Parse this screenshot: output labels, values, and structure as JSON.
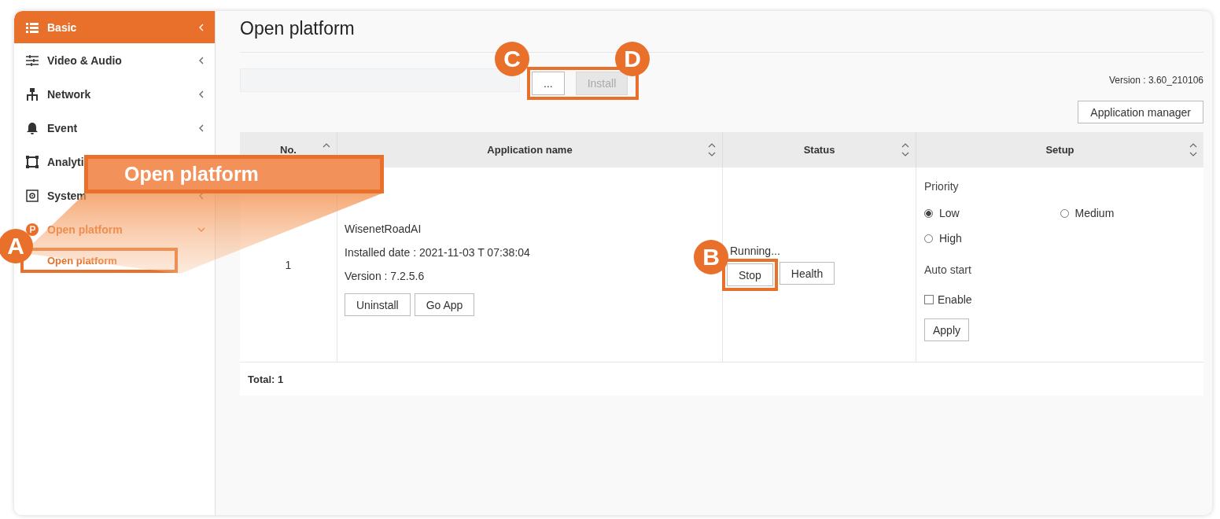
{
  "sidebar": {
    "header": {
      "label": "Basic",
      "expanded": false
    },
    "items": [
      {
        "label": "Video & Audio",
        "expanded": false,
        "selected": false
      },
      {
        "label": "Network",
        "expanded": false,
        "selected": false
      },
      {
        "label": "Event",
        "expanded": false,
        "selected": false
      },
      {
        "label": "Analyti",
        "selected": false
      },
      {
        "label": "System",
        "expanded": false,
        "selected": false
      },
      {
        "label": "Open platform",
        "expanded": true,
        "selected": true,
        "children": [
          {
            "label": "Open platform",
            "selected": true
          }
        ]
      }
    ]
  },
  "page": {
    "title": "Open platform"
  },
  "toolbar": {
    "buttons": [
      {
        "label": "...",
        "disabled": false
      },
      {
        "label": "Install",
        "disabled": true
      }
    ],
    "version": "Version : 3.60_210106",
    "manager_button": "Application manager"
  },
  "table": {
    "columns": [
      {
        "label": "No.",
        "sort_up": true,
        "sort_down": false
      },
      {
        "label": "Application name",
        "sort_up": true,
        "sort_down": true
      },
      {
        "label": "Status",
        "sort_up": true,
        "sort_down": true
      },
      {
        "label": "Setup",
        "sort_up": true,
        "sort_down": true
      }
    ],
    "rows": [
      {
        "no": "1",
        "app": {
          "name": "WisenetRoadAI",
          "installed": "Installed date : 2021-11-03 T 07:38:04",
          "version": "Version : 7.2.5.6",
          "buttons": [
            "Uninstall",
            "Go App"
          ]
        },
        "status": {
          "text": "Running...",
          "buttons": [
            "Stop",
            "Health"
          ]
        },
        "setup": {
          "priority_label": "Priority",
          "options": [
            {
              "label": "Low",
              "selected": true
            },
            {
              "label": "Medium",
              "selected": false
            },
            {
              "label": "High",
              "selected": false
            }
          ],
          "auto_start_label": "Auto start",
          "enable": {
            "label": "Enable",
            "checked": false
          },
          "apply": "Apply"
        }
      }
    ],
    "footer": "Total: 1"
  },
  "callouts": {
    "label": "Open platform",
    "markers": [
      {
        "letter": "A"
      },
      {
        "letter": "B"
      },
      {
        "letter": "C"
      },
      {
        "letter": "D"
      }
    ]
  }
}
